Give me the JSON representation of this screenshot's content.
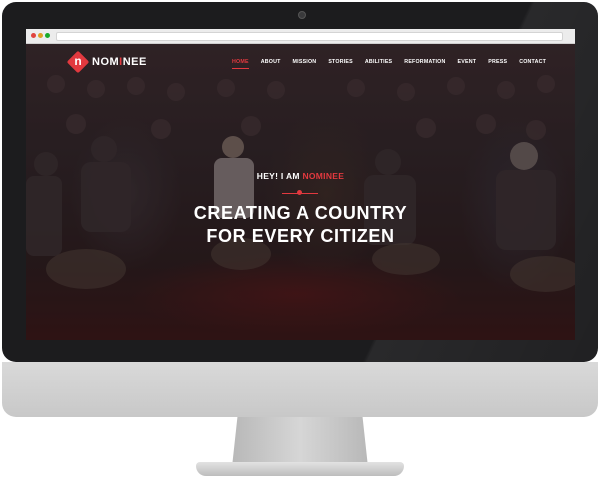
{
  "site": {
    "logo_letter": "n",
    "logo_text_part1": "NOM",
    "logo_text_accent": "I",
    "logo_text_part2": "NEE"
  },
  "nav": {
    "items": [
      {
        "label": "HOME",
        "active": true
      },
      {
        "label": "ABOUT",
        "active": false
      },
      {
        "label": "MISSION",
        "active": false
      },
      {
        "label": "STORIES",
        "active": false
      },
      {
        "label": "ABILITIES",
        "active": false
      },
      {
        "label": "REFORMATION",
        "active": false
      },
      {
        "label": "EVENT",
        "active": false
      },
      {
        "label": "PRESS",
        "active": false
      },
      {
        "label": "CONTACT",
        "active": false
      }
    ]
  },
  "hero": {
    "tagline_prefix": "HEY! I AM ",
    "tagline_accent": "NOMINEE",
    "headline_line1": "CREATING A COUNTRY",
    "headline_line2": "FOR EVERY CITIZEN"
  },
  "colors": {
    "accent": "#e2393f",
    "bezel": "#1c1c1e",
    "hero_overlay": "#2a2226"
  }
}
